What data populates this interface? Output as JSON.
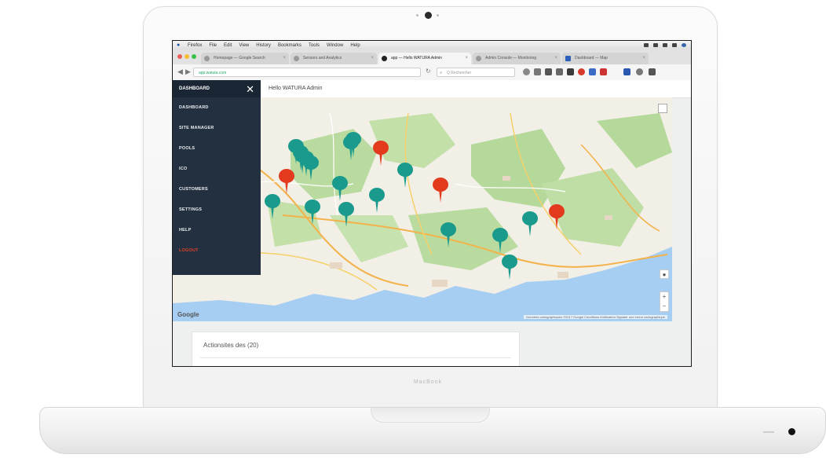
{
  "laptop": {
    "brand": "MacBook"
  },
  "mac_menubar": {
    "items": [
      "Firefox",
      "File",
      "Edit",
      "View",
      "History",
      "Bookmarks",
      "Tools",
      "Window",
      "Help"
    ]
  },
  "browser": {
    "tabs": [
      {
        "label": "Homepage — Google Search",
        "active": false
      },
      {
        "label": "Sensors and Analytics",
        "active": false
      },
      {
        "label": "app — Hello WATURA Admin",
        "active": true
      },
      {
        "label": "Admin Console — Monitoring",
        "active": false
      },
      {
        "label": "Dashboard — Map",
        "active": false
      }
    ],
    "url": "app.watuta.com",
    "search_placeholder": "Q Rechercher"
  },
  "sidebar": {
    "title": "DASHBOARD",
    "items": [
      "DASHBOARD",
      "SITE MANAGER",
      "POOLS",
      "ICO",
      "CUSTOMERS",
      "SETTINGS",
      "HELP",
      "LOGOUT"
    ]
  },
  "header": {
    "greeting": "Hello WATURA Admin"
  },
  "map": {
    "provider": "Google",
    "attribution": "Données cartographiques ©2017 Google Conditions d'utilisation Signaler une erreur cartographique",
    "markers_teal_count": 17,
    "markers_red_count": 4,
    "colors": {
      "teal_marker": "#1a9a8c",
      "red_marker": "#e33a1e",
      "water": "#a6cdf2",
      "forest": "#b9dba0"
    }
  },
  "card": {
    "title": "Actionsites des (20)"
  },
  "colors": {
    "sidebar_bg": "#22303f",
    "logout": "#e0402a"
  }
}
